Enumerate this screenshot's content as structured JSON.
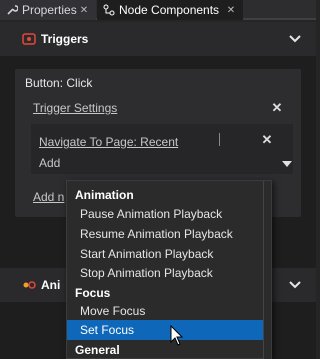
{
  "tabs": [
    {
      "label": "Properties",
      "icon": "wrench-icon"
    },
    {
      "label": "Node Components",
      "icon": "node-components-icon"
    }
  ],
  "triggers_section": {
    "title": "Triggers"
  },
  "trigger": {
    "title": "Button: Click",
    "settings_link": "Trigger Settings",
    "action_link": "Navigate To Page: Recent",
    "add_label": "Add",
    "add_node_label": "Add n"
  },
  "anim_section": {
    "title": "Ani"
  },
  "dropdown": {
    "items": [
      {
        "kind": "header",
        "label": "Animation"
      },
      {
        "kind": "option",
        "label": "Pause Animation Playback"
      },
      {
        "kind": "option",
        "label": "Resume Animation Playback"
      },
      {
        "kind": "option",
        "label": "Start Animation Playback"
      },
      {
        "kind": "option",
        "label": "Stop Animation Playback"
      },
      {
        "kind": "header",
        "label": "Focus"
      },
      {
        "kind": "option",
        "label": "Move Focus"
      },
      {
        "kind": "option",
        "label": "Set Focus",
        "selected": true
      },
      {
        "kind": "header",
        "label": "General"
      }
    ]
  },
  "colors": {
    "accent": "#0e67b8",
    "trigger_icon": "#e0493a",
    "anim_icon": "#f0a020"
  }
}
